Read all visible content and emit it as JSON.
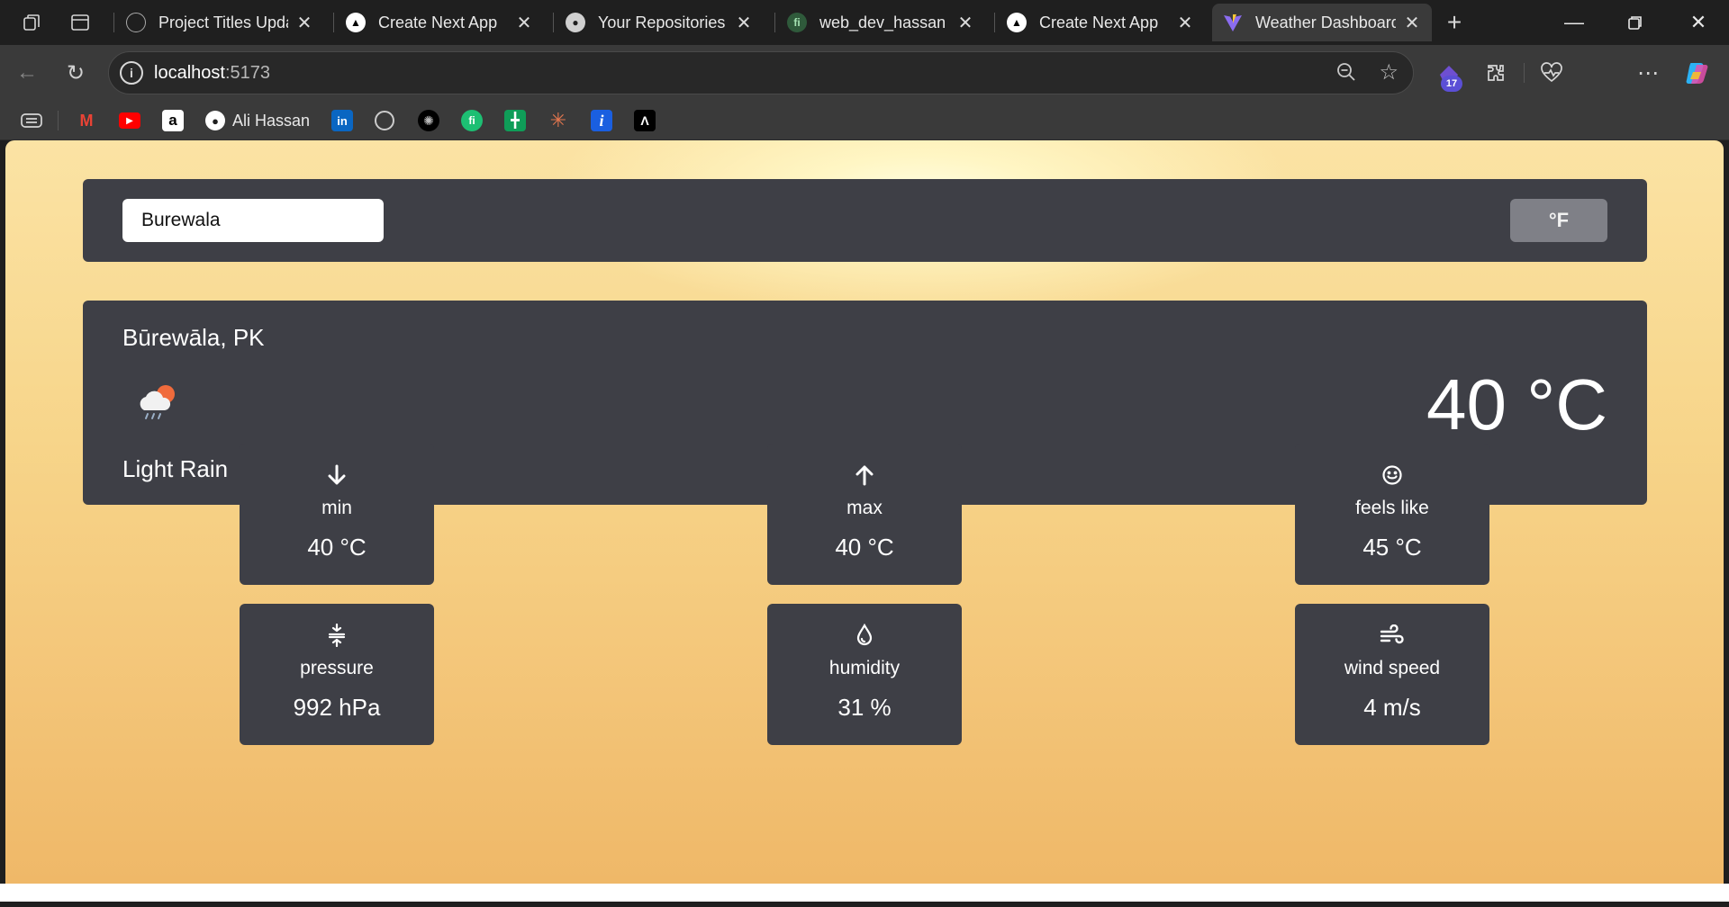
{
  "tabs": [
    {
      "title": "Project Titles Updat",
      "favicon": "openai-icon"
    },
    {
      "title": "Create Next App",
      "favicon": "vercel-triangle-icon"
    },
    {
      "title": "Your Repositories",
      "favicon": "github-icon"
    },
    {
      "title": "web_dev_hassan | F",
      "favicon": "fiverr-icon"
    },
    {
      "title": "Create Next App",
      "favicon": "vercel-triangle-icon"
    },
    {
      "title": "Weather Dashboard",
      "favicon": "vite-icon",
      "active": true
    }
  ],
  "address_bar": {
    "host": "localhost",
    "port": ":5173"
  },
  "toolbar": {
    "extension_badge": "17"
  },
  "bookmarks": [
    {
      "label": "",
      "icon": "gmail-icon"
    },
    {
      "label": "",
      "icon": "youtube-icon"
    },
    {
      "label": "",
      "icon": "amazon-icon"
    },
    {
      "label": "Ali Hassan",
      "icon": "github-icon"
    },
    {
      "label": "",
      "icon": "linkedin-icon"
    },
    {
      "label": "",
      "icon": "openai-icon"
    },
    {
      "label": "",
      "icon": "perplexity-icon"
    },
    {
      "label": "",
      "icon": "fiverr-icon"
    },
    {
      "label": "",
      "icon": "sheets-icon"
    },
    {
      "label": "",
      "icon": "claude-icon"
    },
    {
      "label": "",
      "icon": "info-icon"
    },
    {
      "label": "",
      "icon": "artifact-icon"
    }
  ],
  "weather": {
    "search_value": "Burewala",
    "unit_toggle_label": "°F",
    "location": "Būrewāla, PK",
    "condition": "Light Rain",
    "temperature": "40 °C",
    "stats": [
      {
        "label": "min",
        "value": "40 °C",
        "icon": "arrow-down-icon"
      },
      {
        "label": "max",
        "value": "40 °C",
        "icon": "arrow-up-icon"
      },
      {
        "label": "feels like",
        "value": "45 °C",
        "icon": "smiley-icon"
      },
      {
        "label": "pressure",
        "value": "992 hPa",
        "icon": "pressure-icon"
      },
      {
        "label": "humidity",
        "value": "31 %",
        "icon": "droplet-icon"
      },
      {
        "label": "wind speed",
        "value": "4 m/s",
        "icon": "wind-icon"
      }
    ]
  }
}
